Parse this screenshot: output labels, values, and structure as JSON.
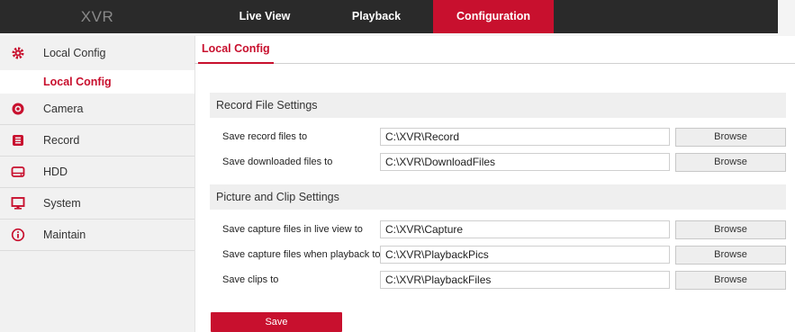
{
  "app": {
    "logo": "XVR"
  },
  "nav": {
    "tabs": [
      {
        "label": "Live View"
      },
      {
        "label": "Playback"
      },
      {
        "label": "Configuration",
        "active": true
      }
    ]
  },
  "sidebar": {
    "items": [
      {
        "label": "Local Config",
        "icon": "gear-icon"
      },
      {
        "label": "Camera",
        "icon": "camera-icon"
      },
      {
        "label": "Record",
        "icon": "record-icon"
      },
      {
        "label": "HDD",
        "icon": "hdd-icon"
      },
      {
        "label": "System",
        "icon": "monitor-icon"
      },
      {
        "label": "Maintain",
        "icon": "info-icon"
      }
    ],
    "sub_item": "Local Config"
  },
  "content": {
    "tab": "Local Config",
    "record_section": {
      "title": "Record File Settings",
      "rows": [
        {
          "label": "Save record files to",
          "value": "C:\\XVR\\Record",
          "button": "Browse"
        },
        {
          "label": "Save downloaded files to",
          "value": "C:\\XVR\\DownloadFiles",
          "button": "Browse"
        }
      ]
    },
    "picture_section": {
      "title": "Picture and Clip Settings",
      "rows": [
        {
          "label": "Save capture files in live view to",
          "value": "C:\\XVR\\Capture",
          "button": "Browse"
        },
        {
          "label": "Save capture files when playback to",
          "value": "C:\\XVR\\PlaybackPics",
          "button": "Browse"
        },
        {
          "label": "Save clips to",
          "value": "C:\\XVR\\PlaybackFiles",
          "button": "Browse"
        }
      ]
    },
    "save_label": "Save"
  },
  "colors": {
    "accent": "#c8102e",
    "topbar": "#2a2a2a",
    "sidebar_bg": "#f1f1f1"
  }
}
